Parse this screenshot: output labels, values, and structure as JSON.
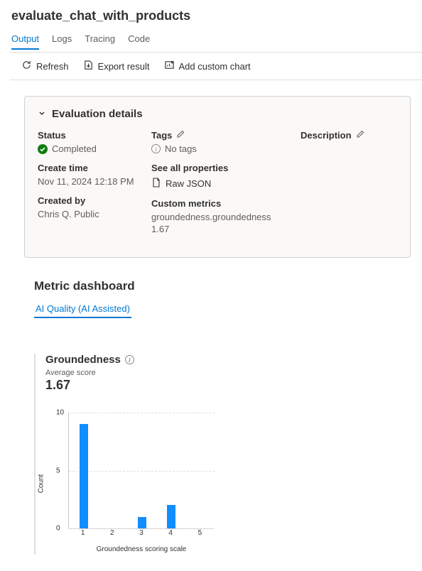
{
  "page_title": "evaluate_chat_with_products",
  "tabs": [
    "Output",
    "Logs",
    "Tracing",
    "Code"
  ],
  "active_tab": 0,
  "toolbar": {
    "refresh": "Refresh",
    "export": "Export result",
    "add_chart": "Add custom chart"
  },
  "details": {
    "header": "Evaluation details",
    "status_label": "Status",
    "status_value": "Completed",
    "create_time_label": "Create time",
    "create_time_value": "Nov 11, 2024 12:18 PM",
    "created_by_label": "Created by",
    "created_by_value": "Chris Q. Public",
    "tags_label": "Tags",
    "no_tags": "No tags",
    "see_all_props": "See all properties",
    "raw_json": "Raw JSON",
    "custom_metrics_label": "Custom metrics",
    "custom_metric_name": "groundedness.groundedness",
    "custom_metric_value": "1.67",
    "description_label": "Description"
  },
  "metric_dashboard": {
    "title": "Metric dashboard",
    "tabs": [
      "AI Quality (AI Assisted)"
    ],
    "chart": {
      "name": "Groundedness",
      "avg_label": "Average score",
      "avg_value": "1.67",
      "ylabel": "Count",
      "xlabel": "Groundedness scoring scale"
    }
  },
  "chart_data": {
    "type": "bar",
    "categories": [
      "1",
      "2",
      "3",
      "4",
      "5"
    ],
    "values": [
      9,
      0,
      1,
      2,
      0
    ],
    "title": "Groundedness",
    "xlabel": "Groundedness scoring scale",
    "ylabel": "Count",
    "ylim": [
      0,
      10
    ],
    "yticks": [
      0,
      5,
      10
    ]
  }
}
